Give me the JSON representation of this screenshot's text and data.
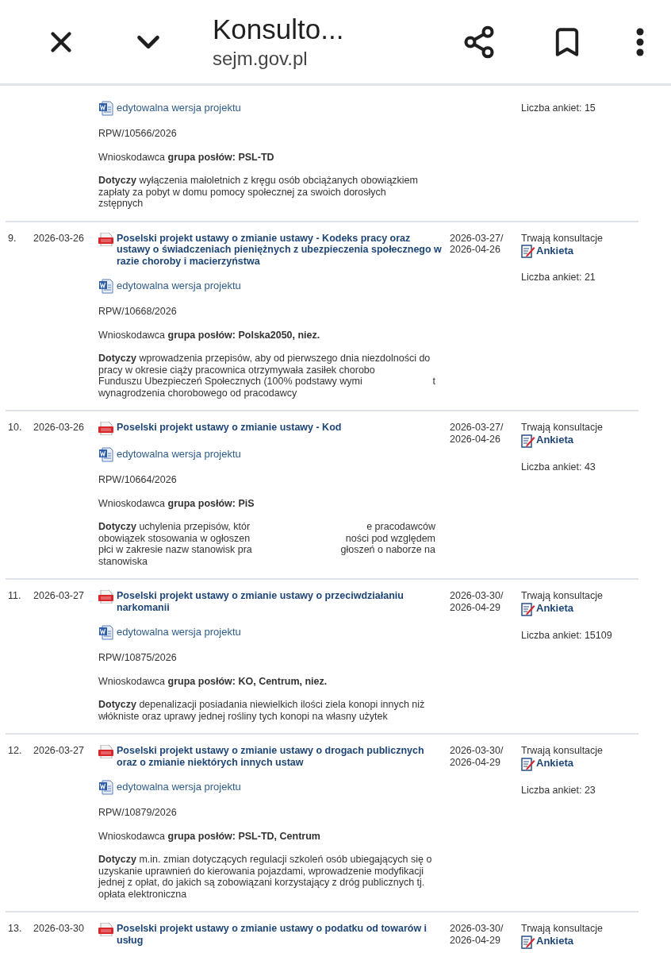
{
  "app_bar": {
    "title": "Konsulto...",
    "domain": "sejm.gov.pl"
  },
  "rows": [
    {
      "editable_link": "edytowalna wersja projektu",
      "rpw": "RPW/10566/2026",
      "applicant": "Wnioskodawca **grupa posłów: PSL-TD**",
      "subject_lines": [
        [
          "**Dotyczy** wyłączenia małoletnich z kręgu osób obciążanych obowiązkiem"
        ],
        [
          "zapłaty za pobyt w domu pomocy społecznej za swoich dorosłych"
        ],
        [
          "zstępnych"
        ]
      ],
      "survey_count": "Liczba ankiet: 15"
    },
    {
      "number": "9.",
      "date": "2026-03-26",
      "title": "Poselski projekt ustawy o zmianie ustawy - Kodeks pracy oraz ustawy o świadczeniach pieniężnych z ubezpieczenia społecznego w razie choroby i macierzyństwa",
      "editable_link": "edytowalna wersja projektu",
      "rpw": "RPW/10668/2026",
      "applicant": "Wnioskodawca **grupa posłów: Polska2050, niez.**",
      "subject_lines": [
        [
          "**Dotyczy** wprowadzenia przepisów, aby od pierwszego dnia niezdolności do"
        ],
        [
          "pracy w okresie ciąży pracownica otrzymywała zasiłek chorobo"
        ],
        [
          "Funduszu Ubezpieczeń Społecznych (100% podstawy wymi",
          "t"
        ],
        [
          "wynagrodzenia chorobowego od pracodawcy"
        ]
      ],
      "period": [
        "2026-03-27/",
        "2026-04-26"
      ],
      "status": "Trwają konsultacje",
      "survey_link": "Ankieta",
      "survey_count": "Liczba ankiet: 21"
    },
    {
      "number": "10.",
      "date": "2026-03-26",
      "title": "Poselski projekt ustawy o zmianie ustawy - Kod",
      "editable_link": "edytowalna wersja projektu",
      "rpw": "RPW/10664/2026",
      "applicant": "Wnioskodawca **grupa posłów: PiS**",
      "subject_lines": [
        [
          "**Dotyczy** uchylenia przepisów, któr",
          "e pracodawców"
        ],
        [
          "obowiązek stosowania w ogłoszen",
          "ności pod względem"
        ],
        [
          "płci w zakresie nazw stanowisk pra",
          "głoszeń o naborze na"
        ],
        [
          "stanowiska"
        ]
      ],
      "period": [
        "2026-03-27/",
        "2026-04-26"
      ],
      "status": "Trwają konsultacje",
      "survey_link": "Ankieta",
      "survey_count": "Liczba ankiet: 43"
    },
    {
      "number": "11.",
      "date": "2026-03-27",
      "title": "Poselski projekt ustawy o zmianie ustawy o przeciwdziałaniu narkomanii",
      "editable_link": "edytowalna wersja projektu",
      "rpw": "RPW/10875/2026",
      "applicant": "Wnioskodawca **grupa posłów: KO, Centrum, niez.**",
      "subject_lines": [
        [
          "**Dotyczy** depenalizacji posiadania niewielkich ilości ziela konopi innych niż"
        ],
        [
          "włókniste oraz uprawy jednej rośliny tych konopi na własny użytek"
        ]
      ],
      "period": [
        "2026-03-30/",
        "2026-04-29"
      ],
      "status": "Trwają konsultacje",
      "survey_link": "Ankieta",
      "survey_count": "Liczba ankiet: 15109"
    },
    {
      "number": "12.",
      "date": "2026-03-27",
      "title": "Poselski projekt ustawy o zmianie ustawy o drogach publicznych oraz o zmianie niektórych innych ustaw",
      "editable_link": "edytowalna wersja projektu",
      "rpw": "RPW/10879/2026",
      "applicant": "Wnioskodawca **grupa posłów: PSL-TD, Centrum**",
      "subject_lines": [
        [
          "**Dotyczy** m.in. zmian dotyczących regulacji szkoleń osób ubiegających się o"
        ],
        [
          "uzyskanie uprawnień do kierowania pojazdami, wprowadzenie modyfikacji"
        ],
        [
          "jednej z opłat, do jakich są zobowiązani korzystający z dróg publicznych tj."
        ],
        [
          "opłata elektroniczna"
        ]
      ],
      "period": [
        "2026-03-30/",
        "2026-04-29"
      ],
      "status": "Trwają konsultacje",
      "survey_link": "Ankieta",
      "survey_count": "Liczba ankiet: 23"
    },
    {
      "number": "13.",
      "date": "2026-03-30",
      "title": "Poselski projekt ustawy o zmianie ustawy o podatku od towarów i usług",
      "period": [
        "2026-03-30/",
        "2026-04-29"
      ],
      "status": "Trwają konsultacje",
      "survey_link": "Ankieta"
    }
  ]
}
